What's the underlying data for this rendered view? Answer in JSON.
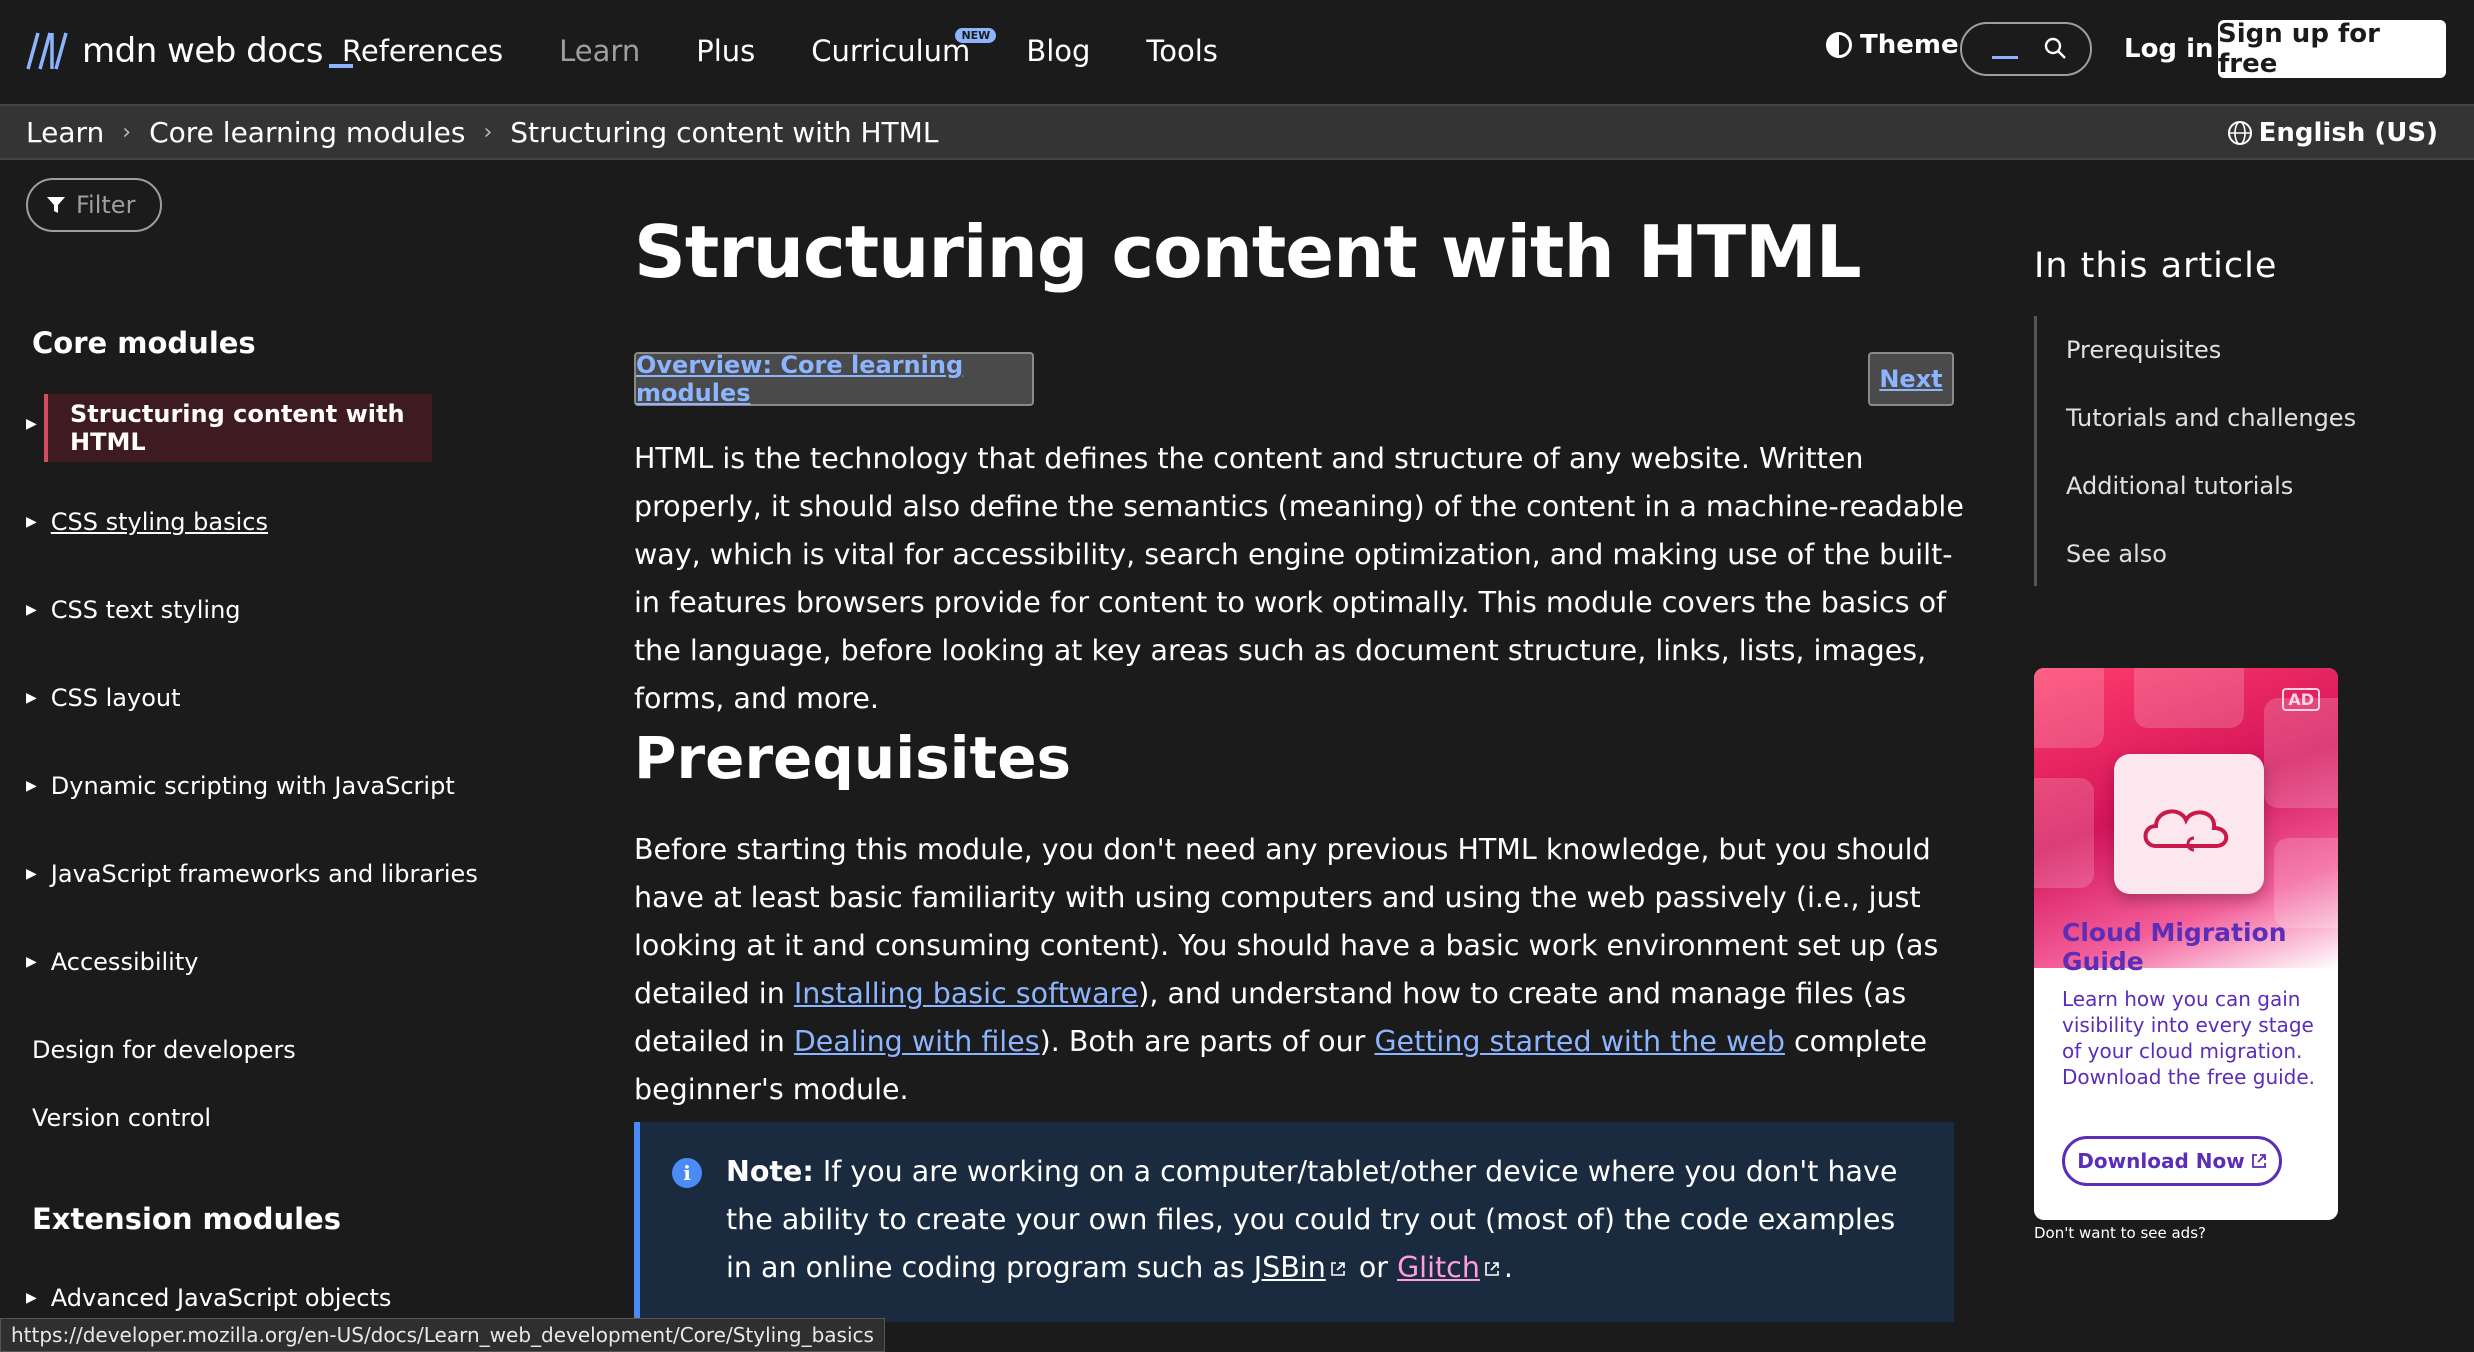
{
  "header": {
    "logo_text": "mdn web docs",
    "nav": [
      {
        "label": "References",
        "dim": false
      },
      {
        "label": "Learn",
        "dim": true
      },
      {
        "label": "Plus",
        "dim": false
      },
      {
        "label": "Curriculum",
        "dim": false,
        "badge": "NEW"
      },
      {
        "label": "Blog",
        "dim": false
      },
      {
        "label": "Tools",
        "dim": false
      }
    ],
    "theme_label": "Theme",
    "login_label": "Log in",
    "signup_label": "Sign up for free"
  },
  "breadcrumb": {
    "items": [
      "Learn",
      "Core learning modules",
      "Structuring content with HTML"
    ],
    "language": "English (US)"
  },
  "sidebar": {
    "filter_label": "Filter",
    "core_heading": "Core modules",
    "core_items": [
      "Structuring content with HTML",
      "CSS styling basics",
      "CSS text styling",
      "CSS layout",
      "Dynamic scripting with JavaScript",
      "JavaScript frameworks and libraries",
      "Accessibility"
    ],
    "plain_items": [
      "Design for developers",
      "Version control"
    ],
    "extension_heading": "Extension modules",
    "extension_items": [
      "Advanced JavaScript objects"
    ]
  },
  "article": {
    "title": "Structuring content with HTML",
    "overview_link": "Overview: Core learning modules",
    "next_link": "Next",
    "intro": "HTML is the technology that defines the content and structure of any website. Written properly, it should also define the semantics (meaning) of the content in a machine-readable way, which is vital for accessibility, search engine optimization, and making use of the built-in features browsers provide for content to work optimally. This module covers the basics of the language, before looking at key areas such as document structure, links, lists, images, forms, and more.",
    "prereq_heading": "Prerequisites",
    "prereq": {
      "part1": "Before starting this module, you don't need any previous HTML knowledge, but you should have at least basic familiarity with using computers and using the web passively (i.e., just looking at it and consuming content). You should have a basic work environment set up (as detailed in ",
      "link1": "Installing basic software",
      "part2": "), and understand how to create and manage files (as detailed in ",
      "link2": "Dealing with files",
      "part3": "). Both are parts of our ",
      "link3": "Getting started with the web",
      "part4": " complete beginner's module."
    },
    "note": {
      "label": "Note:",
      "text": " If you are working on a computer/tablet/other device where you don't have the ability to create your own files, you could try out (most of) the code examples in an online coding program such as ",
      "link1": "JSBin",
      "between": " or ",
      "link2": "Glitch",
      "end": "."
    }
  },
  "toc": {
    "title": "In this article",
    "items": [
      "Prerequisites",
      "Tutorials and challenges",
      "Additional tutorials",
      "See also"
    ]
  },
  "ad": {
    "tag": "AD",
    "title": "Cloud Migration Guide",
    "body": "Learn how you can gain visibility into every stage of your cloud migration. Download the free guide.",
    "button": "Download Now",
    "no_ads": "Don't want to see ads?"
  },
  "status_url": "https://developer.mozilla.org/en-US/docs/Learn_web_development/Core/Styling_basics",
  "colors": {
    "background": "#1b1b1b",
    "link": "#8cb4ff",
    "active_item_bg": "#3e1b20",
    "active_item_border": "#d64c5f",
    "note_bg": "#1a2a3f",
    "note_border": "#4c8bf5",
    "ad_accent": "#5b2db8",
    "glitch_link": "#ff9ee0"
  }
}
